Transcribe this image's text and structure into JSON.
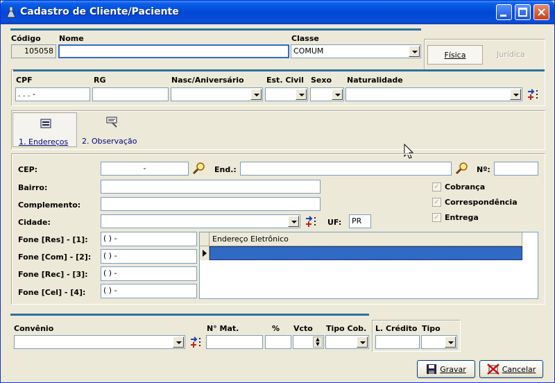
{
  "window": {
    "title": "Cadastro de Cliente/Paciente"
  },
  "header": {
    "codigo_label": "Código",
    "codigo_value": "105058",
    "nome_label": "Nome",
    "nome_value": "",
    "classe_label": "Classe",
    "classe_value": "COMUM",
    "tipo_fisica": "Física",
    "tipo_juridica": "Jurídica"
  },
  "docs": {
    "cpf_label": "CPF",
    "cpf_value": ". . . -",
    "rg_label": "RG",
    "nasc_label": "Nasc/Aniversário",
    "estcivil_label": "Est. Civil",
    "sexo_label": "Sexo",
    "naturalidade_label": "Naturalidade"
  },
  "tabs": [
    {
      "label": "1. Endereços"
    },
    {
      "label": "2. Observação"
    }
  ],
  "address": {
    "cep_label": "CEP:",
    "cep_value": "-",
    "end_label": "End.:",
    "numero_label": "Nº:",
    "bairro_label": "Bairro:",
    "complemento_label": "Complemento:",
    "cidade_label": "Cidade:",
    "uf_label": "UF:",
    "uf_value": "PR",
    "cobranca_label": "Cobrança",
    "correspondencia_label": "Correspondência",
    "entrega_label": "Entrega",
    "fone_res_label": "Fone [Res] - [1]:",
    "fone_com_label": "Fone [Com] - [2]:",
    "fone_rec_label": "Fone [Rec] - [3]:",
    "fone_cel_label": "Fone [Cel] - [4]:",
    "fone_mask": "( )  -",
    "email_header": "Endereço Eletrônico"
  },
  "footer": {
    "convenio_label": "Convênio",
    "nmat_label": "N° Mat.",
    "pct_label": "%",
    "vcto_label": "Vcto",
    "tipocob_label": "Tipo Cob.",
    "lcredito_label": "L. Crédito",
    "tipo_label": "Tipo",
    "gravar_label": "Gravar",
    "cancelar_label": "Cancelar"
  },
  "colors": {
    "titlebar": "#0047d6",
    "selection": "#316ac5",
    "accent_line": "#2d6f9e"
  }
}
